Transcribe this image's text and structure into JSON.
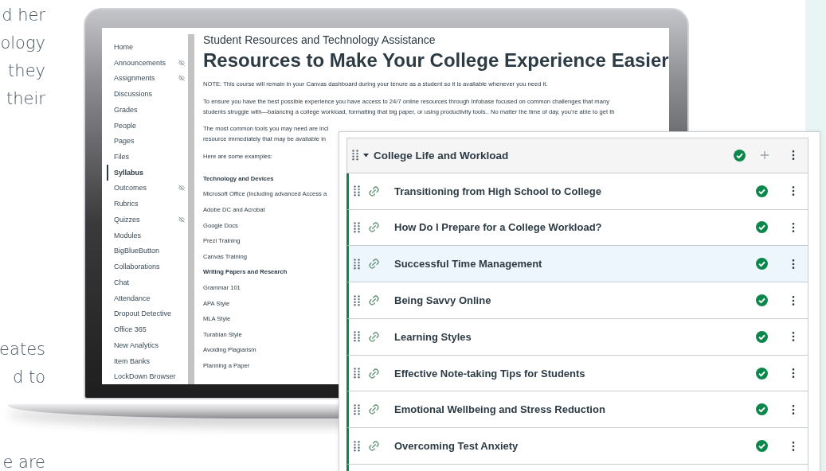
{
  "intro_fragments": {
    "top": [
      "d her",
      "ology",
      "they",
      "their"
    ],
    "middle": [
      "eates",
      "d to"
    ],
    "bottom": [
      "e are"
    ]
  },
  "course": {
    "sidebar": [
      {
        "label": "Home",
        "selected": false,
        "hidden": false
      },
      {
        "label": "Announcements",
        "selected": false,
        "hidden": true
      },
      {
        "label": "Assignments",
        "selected": false,
        "hidden": true
      },
      {
        "label": "Discussions",
        "selected": false,
        "hidden": false
      },
      {
        "label": "Grades",
        "selected": false,
        "hidden": false
      },
      {
        "label": "People",
        "selected": false,
        "hidden": false
      },
      {
        "label": "Pages",
        "selected": false,
        "hidden": false
      },
      {
        "label": "Files",
        "selected": false,
        "hidden": false
      },
      {
        "label": "Syllabus",
        "selected": true,
        "hidden": false
      },
      {
        "label": "Outcomes",
        "selected": false,
        "hidden": true
      },
      {
        "label": "Rubrics",
        "selected": false,
        "hidden": false
      },
      {
        "label": "Quizzes",
        "selected": false,
        "hidden": true
      },
      {
        "label": "Modules",
        "selected": false,
        "hidden": false
      },
      {
        "label": "BigBlueButton",
        "selected": false,
        "hidden": false
      },
      {
        "label": "Collaborations",
        "selected": false,
        "hidden": false
      },
      {
        "label": "Chat",
        "selected": false,
        "hidden": false
      },
      {
        "label": "Attendance",
        "selected": false,
        "hidden": false
      },
      {
        "label": "Dropout Detective",
        "selected": false,
        "hidden": false
      },
      {
        "label": "Office 365",
        "selected": false,
        "hidden": false
      },
      {
        "label": "New Analytics",
        "selected": false,
        "hidden": false
      },
      {
        "label": "Item Banks",
        "selected": false,
        "hidden": false
      },
      {
        "label": "LockDown Browser",
        "selected": false,
        "hidden": false
      }
    ],
    "subtitle": "Student Resources and Technology Assistance",
    "title": "Resources to Make Your College Experience Easier",
    "paragraphs": [
      {
        "lines": [
          "NOTE: This course will remain in your Canvas dashboard during your tenure as a student so it is available whenever you need it."
        ]
      },
      {
        "lines": [
          "To ensure you have the best possible experience  you have access to 24/7 online resources through  Infobase focused on common challenges that many",
          "students struggle with—balancing a college workload, formatting that big paper, or using productivity tools.. No matter the time of day, you’re able to get th"
        ]
      },
      {
        "lines": [
          "The most common tools you may need are incl",
          "resource immediately that may be available in"
        ]
      },
      {
        "lines": [
          "Here are some examples:"
        ]
      }
    ],
    "examples": [
      {
        "kind": "heading",
        "text": "Technology and Devices"
      },
      {
        "kind": "item",
        "text": "Microsoft Office (Including advanced Access a"
      },
      {
        "kind": "item",
        "text": "Adobe  DC and Acrobat"
      },
      {
        "kind": "item",
        "text": "Google Docs"
      },
      {
        "kind": "item",
        "text": "Prezi Training"
      },
      {
        "kind": "item",
        "text": "Canvas Training"
      },
      {
        "kind": "heading",
        "text": "Writing Papers and Research"
      },
      {
        "kind": "item",
        "text": "Grammar 101"
      },
      {
        "kind": "item",
        "text": "APA Style"
      },
      {
        "kind": "item",
        "text": "MLA Style"
      },
      {
        "kind": "item",
        "text": "Turabian Style"
      },
      {
        "kind": "item",
        "text": "Avoiding Plagiarism"
      },
      {
        "kind": "item",
        "text": "Planning a Paper"
      }
    ]
  },
  "module": {
    "title": "College Life and Workload",
    "expanded": true,
    "published": true,
    "items": [
      {
        "title": "Transitioning from High School to College",
        "selected": false,
        "published": true
      },
      {
        "title": "How Do I Prepare for a College Workload?",
        "selected": false,
        "published": true
      },
      {
        "title": "Successful Time Management",
        "selected": true,
        "published": true
      },
      {
        "title": "Being Savvy Online",
        "selected": false,
        "published": true
      },
      {
        "title": "Learning Styles",
        "selected": false,
        "published": true
      },
      {
        "title": "Effective Note-taking Tips for Students",
        "selected": false,
        "published": true
      },
      {
        "title": "Emotional Wellbeing and Stress Reduction",
        "selected": false,
        "published": true
      },
      {
        "title": "Overcoming Test Anxiety",
        "selected": false,
        "published": true
      }
    ]
  }
}
